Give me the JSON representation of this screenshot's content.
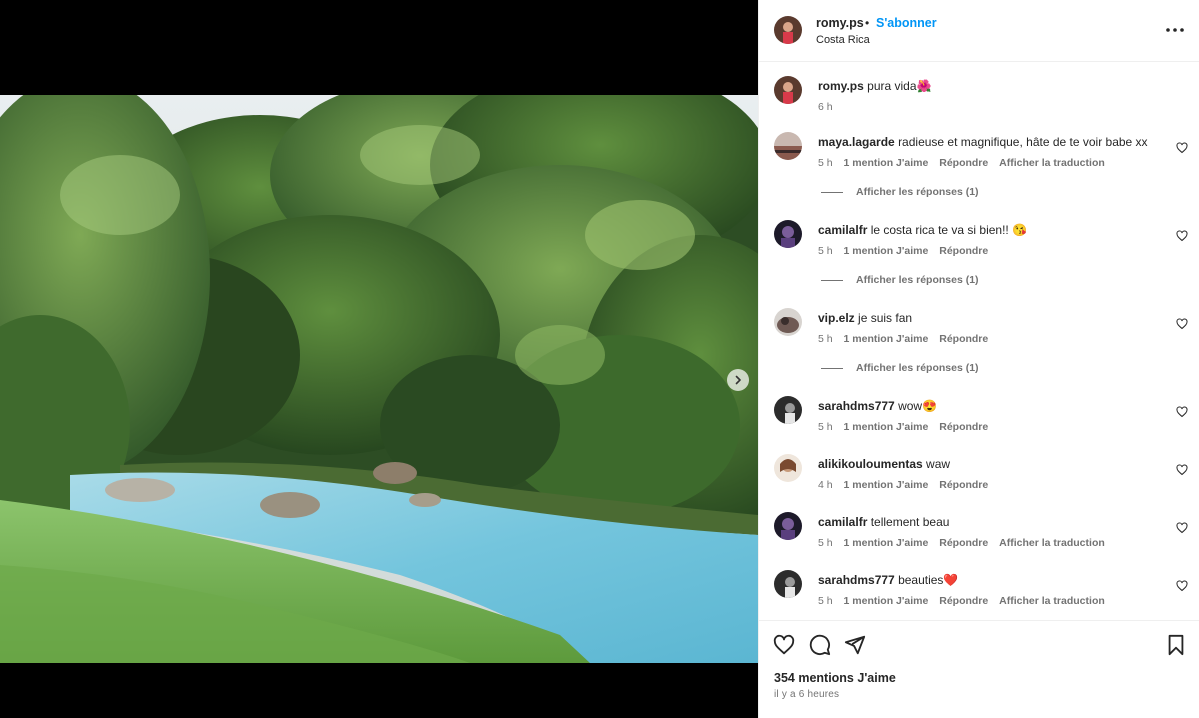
{
  "post": {
    "username": "romy.ps",
    "separator": "•",
    "follow_label": "S'abonner",
    "location": "Costa Rica",
    "caption": {
      "username": "romy.ps",
      "text": "pura vida",
      "emoji": "🌺",
      "time": "6 h"
    }
  },
  "comments": [
    {
      "username": "maya.lagarde",
      "text": "radieuse et magnifique, hâte de te voir babe xx",
      "time": "5 h",
      "likes": "1 mention J'aime",
      "reply": "Répondre",
      "translate": "Afficher la traduction",
      "replies": "Afficher les réponses (1)"
    },
    {
      "username": "camilalfr",
      "text": "le costa rica te va si bien!! 😘",
      "time": "5 h",
      "likes": "1 mention J'aime",
      "reply": "Répondre",
      "translate": "",
      "replies": "Afficher les réponses (1)"
    },
    {
      "username": "vip.elz",
      "text": "je suis fan",
      "time": "5 h",
      "likes": "1 mention J'aime",
      "reply": "Répondre",
      "translate": "",
      "replies": "Afficher les réponses (1)"
    },
    {
      "username": "sarahdms777",
      "text": "wow😍",
      "time": "5 h",
      "likes": "1 mention J'aime",
      "reply": "Répondre",
      "translate": "",
      "replies": ""
    },
    {
      "username": "alikikouloumentas",
      "text": "waw",
      "time": "4 h",
      "likes": "1 mention J'aime",
      "reply": "Répondre",
      "translate": "",
      "replies": ""
    },
    {
      "username": "camilalfr",
      "text": "tellement beau",
      "time": "5 h",
      "likes": "1 mention J'aime",
      "reply": "Répondre",
      "translate": "Afficher la traduction",
      "replies": ""
    },
    {
      "username": "sarahdms777",
      "text": "beauties❤️",
      "time": "5 h",
      "likes": "1 mention J'aime",
      "reply": "Répondre",
      "translate": "Afficher la traduction",
      "replies": ""
    }
  ],
  "footer": {
    "likes_count": "354 mentions J'aime",
    "posted_ago": "il y a 6 heures"
  },
  "icons": {
    "like": "heart-icon",
    "comment": "comment-icon",
    "share": "paper-plane-icon",
    "save": "bookmark-icon",
    "more": "more-options-icon",
    "next": "chevron-right-icon"
  },
  "colors": {
    "follow": "#0095f6",
    "meta": "#737373",
    "text": "#262626",
    "border": "#efefef"
  }
}
